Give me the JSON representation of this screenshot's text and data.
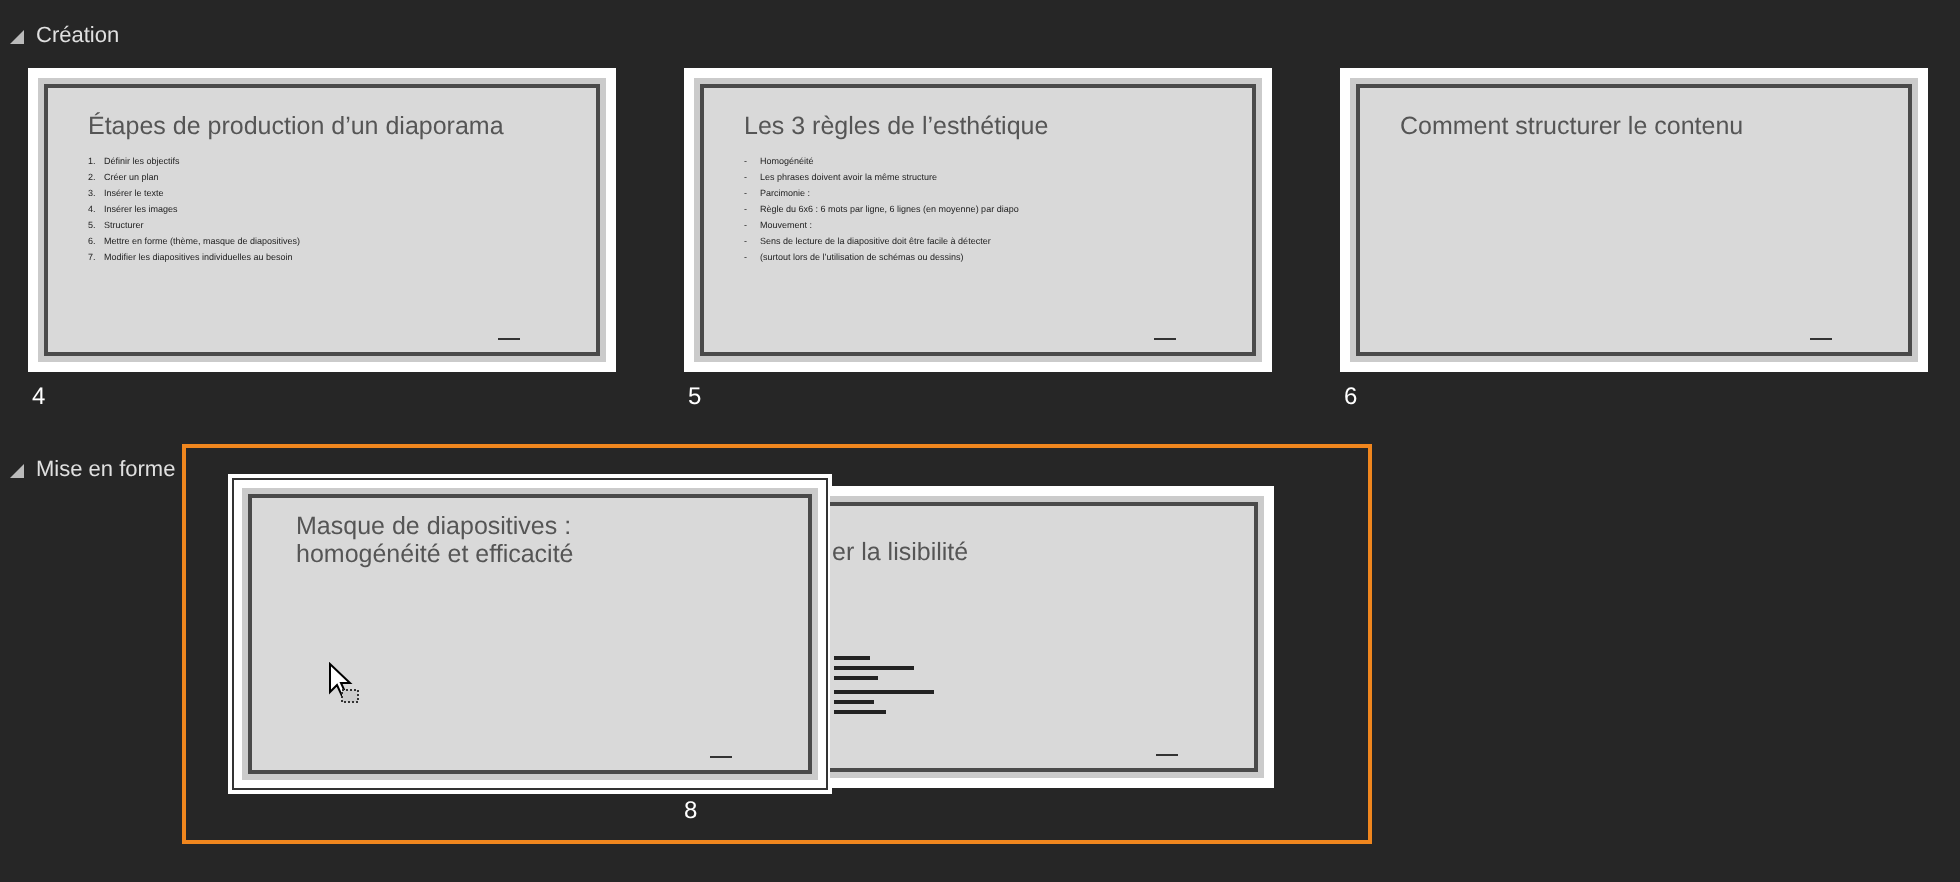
{
  "sections": [
    {
      "title": "Création",
      "expanded": true,
      "slides": [
        {
          "kind": "normal",
          "number": "4",
          "title": "Étapes de production d’un diaporama",
          "bullets": [
            {
              "marker": "1.",
              "text": "Définir les objectifs"
            },
            {
              "marker": "2.",
              "text": "Créer un plan"
            },
            {
              "marker": "3.",
              "text": "Insérer le texte"
            },
            {
              "marker": "4.",
              "text": "Insérer les images"
            },
            {
              "marker": "5.",
              "text": "Structurer"
            },
            {
              "marker": "6.",
              "text": "Mettre en forme (thème, masque de diapositives)"
            },
            {
              "marker": "7.",
              "text": "Modifier les diapositives individuelles au besoin"
            }
          ]
        },
        {
          "kind": "normal",
          "number": "5",
          "title": "Les 3 règles de l’esthétique",
          "bullets": [
            {
              "marker": "-",
              "text": "Homogénéité"
            },
            {
              "marker": "-",
              "text": "Les phrases doivent avoir la même structure"
            },
            {
              "marker": "-",
              "text": "Parcimonie :"
            },
            {
              "marker": "-",
              "text": "Règle du 6x6 : 6 mots par ligne, 6 lignes (en moyenne) par diapo"
            },
            {
              "marker": "-",
              "text": "Mouvement :"
            },
            {
              "marker": "-",
              "text": "Sens de lecture de la diapositive doit être facile à détecter"
            },
            {
              "marker": "-",
              "text": "(surtout lors de l’utilisation de schémas ou dessins)"
            }
          ]
        },
        {
          "kind": "normal",
          "number": "6",
          "title": "Comment structurer le contenu"
        }
      ]
    },
    {
      "title": "Mise en forme",
      "expanded": true,
      "selected": true,
      "slides": [
        {
          "kind": "dragged",
          "number": "8",
          "title": "Masque de diapositives :\nhomogénéité et efficacité"
        },
        {
          "kind": "hidden",
          "title": "er la lisibilité"
        }
      ]
    }
  ]
}
